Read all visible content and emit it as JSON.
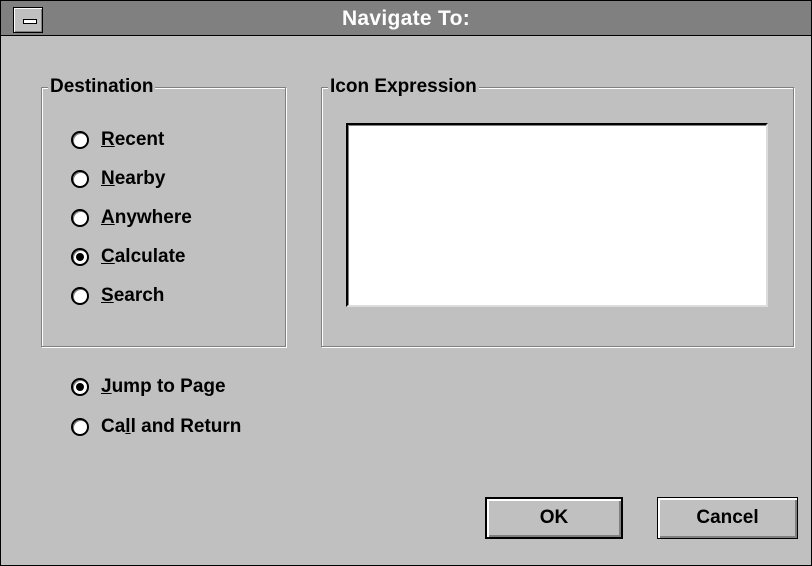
{
  "window": {
    "title": "Navigate To:"
  },
  "destination": {
    "legend": "Destination",
    "options": [
      {
        "label": "Recent",
        "mnemonic": "R",
        "rest": "ecent",
        "selected": false
      },
      {
        "label": "Nearby",
        "mnemonic": "N",
        "rest": "earby",
        "selected": false
      },
      {
        "label": "Anywhere",
        "mnemonic": "A",
        "rest": "nywhere",
        "selected": false
      },
      {
        "label": "Calculate",
        "mnemonic": "C",
        "rest": "alculate",
        "selected": true
      },
      {
        "label": "Search",
        "mnemonic": "S",
        "rest": "earch",
        "selected": false
      }
    ]
  },
  "icon_expression": {
    "legend": "Icon Expression",
    "value": ""
  },
  "mode": {
    "options": [
      {
        "label": "Jump to Page",
        "pre": "",
        "mnemonic": "J",
        "rest": "ump to Page",
        "selected": true
      },
      {
        "label": "Call and Return",
        "pre": "Ca",
        "mnemonic": "l",
        "rest": "l and Return",
        "selected": false
      }
    ]
  },
  "buttons": {
    "ok": "OK",
    "cancel": "Cancel"
  }
}
